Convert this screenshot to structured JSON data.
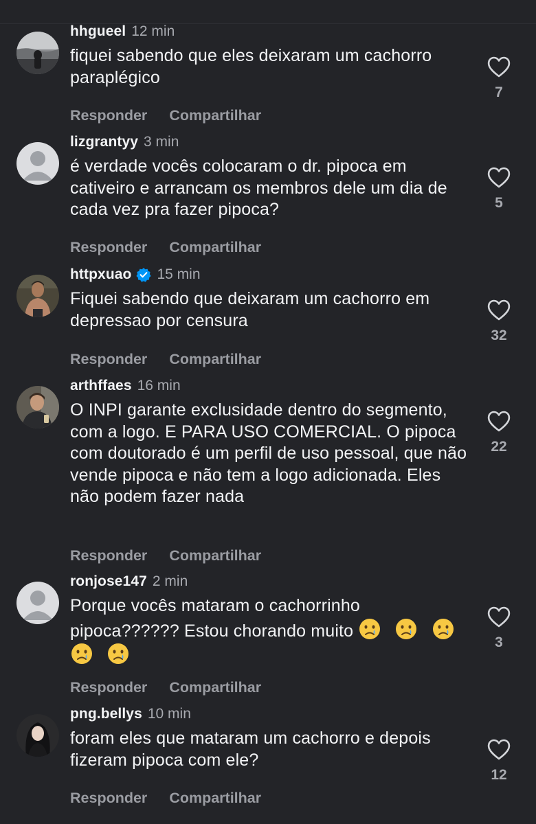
{
  "comments": [
    {
      "username": "hhgueel",
      "time": "12 min",
      "text": "fiquei sabendo que eles deixaram um cachorro paraplégico",
      "likes": "7",
      "verified": false,
      "avatar": "photo-landscape"
    },
    {
      "username": "lizgrantyy",
      "time": "3 min",
      "text": "é verdade vocês colocaram o dr. pipoca em cativeiro e arrancam os membros dele um dia de cada vez pra fazer pipoca?",
      "likes": "5",
      "verified": false,
      "avatar": "default-silhouette"
    },
    {
      "username": "httpxuao",
      "time": "15 min",
      "text": "Fiquei sabendo que deixaram um cachorro em depressao por censura",
      "likes": "32",
      "verified": true,
      "avatar": "photo-person"
    },
    {
      "username": "arthffaes",
      "time": "16 min",
      "text": "O INPI garante exclusidade dentro do segmento, com a logo. E PARA USO COMERCIAL. O pipoca com doutorado é um perfil de uso pessoal, que não vende pipoca e não tem a logo adicionada. Eles não podem fazer nada",
      "likes": "22",
      "verified": false,
      "avatar": "photo-person"
    },
    {
      "username": "ronjose147",
      "time": "2 min",
      "text": "Porque vocês mataram o cachorrinho pipoca?????? Estou chorando muito",
      "emojis": [
        "😢",
        "😢",
        "😢",
        "😢",
        "😢"
      ],
      "likes": "3",
      "verified": false,
      "avatar": "default-silhouette"
    },
    {
      "username": "png.bellys",
      "time": "10 min",
      "text": "foram eles que mataram um cachorro e depois fizeram pipoca com ele?",
      "likes": "12",
      "verified": false,
      "avatar": "photo-person"
    }
  ],
  "actions": {
    "reply_label": "Responder",
    "share_label": "Compartilhar"
  },
  "icons": {
    "like": "heart-outline-icon",
    "verified": "verified-badge-icon",
    "emoji": "crying-face-emoji"
  },
  "colors": {
    "background": "#232428",
    "text": "#f2f3f5",
    "muted": "#9a9ca2",
    "verified": "#0095f6"
  }
}
